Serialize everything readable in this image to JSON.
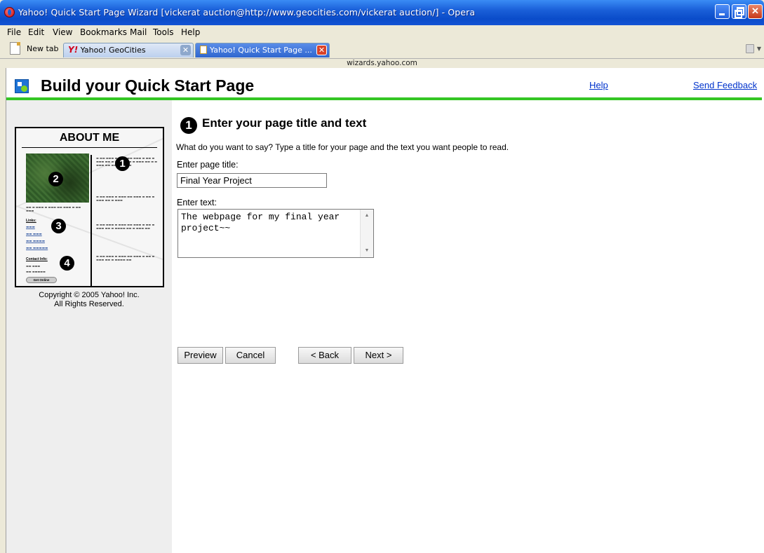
{
  "window": {
    "title": "Yahoo! Quick Start Page Wizard [vickerat auction@http://www.geocities.com/vickerat auction/] - Opera",
    "minimize_icon": "minimize-icon",
    "maximize_icon": "restore-icon",
    "close_icon": "close-icon"
  },
  "menu": [
    "File",
    "Edit",
    "View",
    "Bookmarks",
    "Mail",
    "Tools",
    "Help"
  ],
  "tabs": {
    "new_tab_label": "New tab",
    "items": [
      {
        "label": "Yahoo! GeoCities",
        "active": false
      },
      {
        "label": "Yahoo! Quick Start Page ...",
        "active": true
      }
    ]
  },
  "address": "wizards.yahoo.com",
  "header": {
    "title": "Build your Quick Start Page",
    "help": "Help",
    "feedback": "Send Feedback",
    "accent_color": "#34c624"
  },
  "sidebar": {
    "preview_title": "ABOUT ME",
    "badges": [
      "1",
      "2",
      "3",
      "4"
    ],
    "links_heading": "Links:",
    "contact_heading": "Contact Info:",
    "get_online": "Get Online",
    "copyright_line1": "Copyright © 2005 Yahoo! Inc.",
    "copyright_line2": "All Rights Reserved."
  },
  "step": {
    "number": "1",
    "heading": "Enter your page title and text",
    "instructions": "What do you want to say? Type a title for your page and the text you want people to read.",
    "title_label": "Enter page title:",
    "title_value": "Final Year Project",
    "text_label": "Enter text:",
    "text_value": "The webpage for my final year project~~"
  },
  "buttons": {
    "preview": "Preview",
    "cancel": "Cancel",
    "back": "< Back",
    "next": "Next >"
  }
}
